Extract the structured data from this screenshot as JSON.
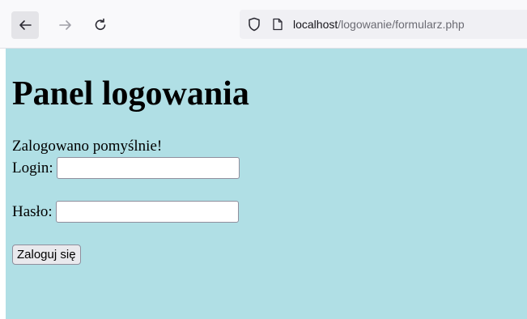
{
  "browser": {
    "url_host": "localhost",
    "url_path": "/logowanie/formularz.php"
  },
  "page": {
    "title": "Panel logowania",
    "message": "Zalogowano pomyślnie!",
    "login_label": "Login:",
    "login_value": "",
    "password_label": "Hasło:",
    "password_value": "",
    "submit_label": "Zaloguj się"
  },
  "icons": {
    "back": "arrow-left-icon",
    "forward": "arrow-right-icon",
    "reload": "reload-icon",
    "tracking": "shield-icon",
    "page": "page-icon"
  },
  "colors": {
    "page_background": "#b0dfe5"
  }
}
